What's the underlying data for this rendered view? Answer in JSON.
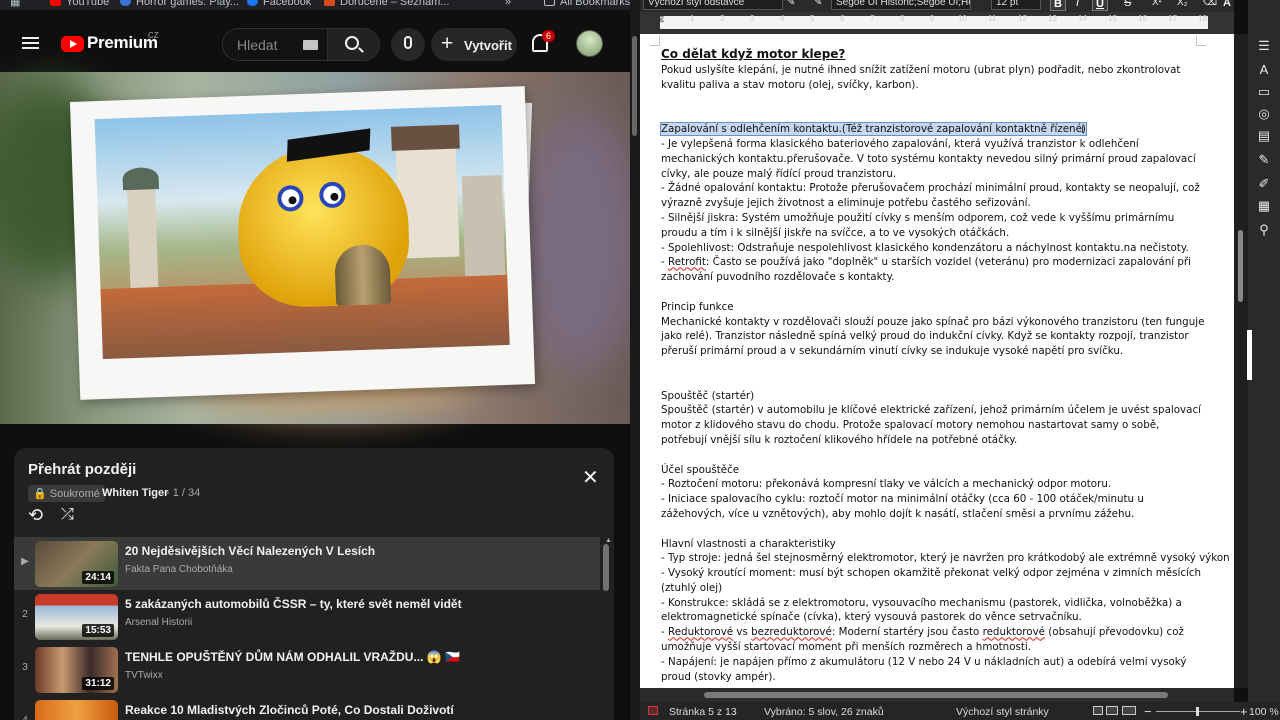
{
  "bookmarks": [
    {
      "label": "YouTube",
      "color": "#ff0000"
    },
    {
      "label": "Horror games: Play...",
      "color": "#3c6fd8"
    },
    {
      "label": "Facebook",
      "color": "#1877f2"
    },
    {
      "label": "Doručené – Seznam...",
      "color": "#d64b22"
    }
  ],
  "all_bookmarks": "All Bookmarks",
  "youtube": {
    "logo_text": "Premium",
    "region": "CZ",
    "search_placeholder": "Hledat",
    "create_label": "Vytvořit",
    "notification_count": "6"
  },
  "playlist": {
    "title": "Přehrát později",
    "privacy": "Soukromé",
    "owner": "Whiten Tiger",
    "position": "- 1 / 34",
    "items": [
      {
        "index": "▶",
        "title": "20 Nejděsivějších Věcí Nalezených V Lesích",
        "channel": "Fakta Pana Chobotňáka",
        "duration": "24:14"
      },
      {
        "index": "2",
        "title": "5 zakázaných automobilů ČSSR – ty, které svět neměl vidět",
        "channel": "Arsenal Historii",
        "duration": "15:53"
      },
      {
        "index": "3",
        "title": "TENHLE OPUŠTĚNÝ DŮM NÁM ODHALIL VRAŽDU... 😱 🇨🇿",
        "channel": "TVTwixx",
        "duration": "31:12"
      },
      {
        "index": "4",
        "title": "Reakce 10 Mladistvých Zločinců Poté, Co Dostali Doživotí",
        "channel": "",
        "duration": ""
      }
    ]
  },
  "writer": {
    "style": "Výchozí styl odstavce",
    "font": "Segoe UI Historic;Segoe UI;Hel",
    "size": "12 pt",
    "bold": "B",
    "italic": "I",
    "underline": "U",
    "ruler": [
      "1",
      "2",
      "3",
      "4",
      "5",
      "6",
      "7",
      "8",
      "9",
      "10",
      "11",
      "12",
      "13",
      "14",
      "15",
      "16",
      "17",
      "18"
    ]
  },
  "document": {
    "heading": "Co dělat když motor klepe?",
    "intro": "Pokud uslyšíte klepání, je nutné ihned snížit zatížení motoru (ubrat plyn) podřadit, nebo zkontrolovat kvalitu paliva a stav motoru (olej, svíčky, karbon).",
    "selected": "Zapalování s odlehčením kontaktu.(Též tranzistorové zapalování kontaktně řízené)",
    "p1": "- Je vylepšená forma klasického bateriového zapalování, která využívá tranzistor k odlehčení mechanických kontaktu.přerušovače. V toto systému kontakty nevedou silný primární proud zapalovací cívky, ale pouze malý řídící proud tranzistoru.",
    "p2": "- Žádné opalování kontaktu: Protože přerušovačem prochází minimální proud, kontakty se neopalují, což výrazně zvyšuje jejich životnost a eliminuje potřebu častého seřizování.",
    "p3": "- Silnější jiskra: Systém umožňuje použití cívky s menším odporem, což vede k vyššímu primárnímu proudu a tím i k silnější jiskře na svíčce, a to ve vysokých otáčkách.",
    "p4": "- Spolehlivost: Odstraňuje nespolehlivost klasického kondenzátoru a náchylnost kontaktu.na nečistoty.",
    "p5_a": "- ",
    "p5_word": "Retrofit",
    "p5_b": ": Často se používá jako \"doplněk\" u starších vozidel (veteránu) pro modernizaci zapalování při zachování puvodního rozdělovače s kontakty.",
    "princip_h": "Princip funkce",
    "princip": "Mechanické kontakty v rozdělovači slouží pouze jako spínač pro bázi výkonového tranzistoru (ten funguje jako relé). Tranzistor následně spíná velký proud do indukční cívky. Když se kontakty rozpojí, tranzistor přeruší primární proud a v sekundárním vinutí cívky se indukuje vysoké napětí pro svíčku.",
    "spoustec_h": "Spouštěč (startér)",
    "spoustec": "Spouštěč (startér) v automobilu je klíčové elektrické zařízení, jehož primárním účelem je uvést spalovací motor z klidového stavu do chodu. Protože spalovací motory nemohou nastartovat samy o sobě, potřebují vnější sílu k roztočení klikového hřídele na potřebné otáčky.",
    "ucel_h": "Účel spouštěče",
    "ucel1": "- Roztočení motoru: překonává kompresní tlaky ve válcích a mechanický odpor motoru.",
    "ucel2": "- Iniciace spalovacího cyklu: roztočí motor na minimální otáčky (cca 60 - 100 otáček/minutu u zážehových, více u vznětových), aby mohlo dojít k nasátí, stlačení směsi a prvnímu zážehu.",
    "hlavni_h": "Hlavní vlastnosti a charakteristiky",
    "h1": "- Typ stroje: jedná šel stejnosměrný elektromotor, který je navržen pro krátkodobý ale extrémně vysoký výkon",
    "h2": "- Vysoký kroutící moment: musí být schopen okamžitě překonat velký odpor zejména v zimních měsících (ztuhlý olej)",
    "h3": "- Konstrukce: skládá se z elektromotoru, vysouvacího mechanismu (pastorek, vidlička, volnoběžka) a elektromagnetické spínače (cívka), který vysouvá pastorek do věnce setrvačníku.",
    "h4_w1": "Reduktorové",
    "h4_vs": " vs ",
    "h4_w2": "bezreduktorové",
    "h4_mid": ": Moderní startéry jsou často ",
    "h4_w3": "reduktorové",
    "h4_end": " (obsahují převodovku) což umožňuje vyšší startovací moment při menších rozměrech a hmotnosti.",
    "h5": "- Napájení: je napájen přímo z akumulátoru (12 V nebo 24 V u nákladních aut) a odebírá velmi vysoký proud (stovky ampér)."
  },
  "status": {
    "page": "Stránka 5 z 13",
    "selection": "Vybráno: 5 slov, 26 znaků",
    "page_style": "Výchozí styl stránky",
    "zoom": "100 %"
  }
}
